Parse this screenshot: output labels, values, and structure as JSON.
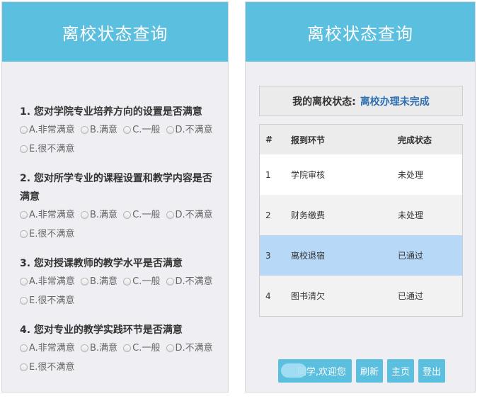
{
  "left": {
    "title": "离校状态查询",
    "questions": [
      {
        "text": "1. 您对学院专业培养方向的设置是否满意",
        "options": [
          "A.非常满意",
          "B.满意",
          "C.一般",
          "D.不满意",
          "E.很不满意"
        ]
      },
      {
        "text": "2. 您对所学专业的课程设置和教学内容是否满意",
        "options": [
          "A.非常满意",
          "B.满意",
          "C.一般",
          "D.不满意",
          "E.很不满意"
        ]
      },
      {
        "text": "3. 您对授课教师的教学水平是否满意",
        "options": [
          "A.非常满意",
          "B.满意",
          "C.一般",
          "D.不满意",
          "E.很不满意"
        ]
      },
      {
        "text": "4. 您对专业的教学实践环节是否满意",
        "options": [
          "A.非常满意",
          "B.满意",
          "C.一般",
          "D.不满意",
          "E.很不满意"
        ]
      }
    ]
  },
  "right": {
    "title": "离校状态查询",
    "status_label": "我的离校状态:",
    "status_value": "离校办理未完成",
    "table": {
      "headers": [
        "#",
        "报到环节",
        "完成状态"
      ],
      "rows": [
        [
          "1",
          "学院审核",
          "未处理"
        ],
        [
          "2",
          "财务缴费",
          "未处理"
        ],
        [
          "3",
          "离校退宿",
          "已通过"
        ],
        [
          "4",
          "图书清欠",
          "已通过"
        ]
      ]
    },
    "footer": {
      "welcome": "同学,欢迎您",
      "refresh": "刷新",
      "home": "主页",
      "logout": "登出"
    }
  },
  "colors": {
    "header_bg": "#5bbfdf",
    "highlight_row": "#b8d8f8",
    "status_value": "#2d6fb0"
  }
}
